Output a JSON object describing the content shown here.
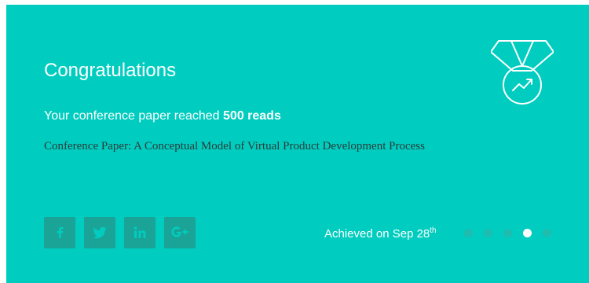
{
  "card": {
    "title": "Congratulations",
    "message_prefix": "Your conference paper reached ",
    "message_highlight": "500 reads",
    "paper_title": "Conference Paper: A Conceptual Model of Virtual Product Development Process",
    "achieved_prefix": "Achieved on Sep 28",
    "achieved_suffix": "th"
  },
  "social": [
    {
      "name": "facebook",
      "glyph": "f"
    },
    {
      "name": "twitter",
      "glyph": "t"
    },
    {
      "name": "linkedin",
      "glyph": "in"
    },
    {
      "name": "google-plus",
      "glyph": "G+"
    }
  ],
  "carousel": {
    "total": 5,
    "active_index": 3
  },
  "colors": {
    "background": "#00cdbf",
    "button": "#1aa397",
    "inactive_dot": "#1fbcb0",
    "active_dot": "#ffffff"
  },
  "icons": {
    "medal": "medal-trend-icon"
  }
}
